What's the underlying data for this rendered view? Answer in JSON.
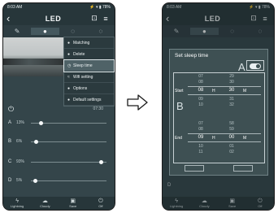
{
  "left_screen": {
    "status": {
      "time": "8:03 AM",
      "icons": "⚡ ▾ ▮ 78%"
    },
    "title": "LED",
    "menu": {
      "items": [
        {
          "label": "Matching"
        },
        {
          "label": "Delete"
        },
        {
          "label": "Sleep time"
        },
        {
          "label": "Wifi setting"
        },
        {
          "label": "Options"
        },
        {
          "label": "Default settings"
        }
      ]
    },
    "time_row": {
      "value": "07:30"
    },
    "channels": [
      {
        "letter": "A",
        "percent": "13%",
        "level": 0.13
      },
      {
        "letter": "B",
        "percent": "6%",
        "level": 0.06
      },
      {
        "letter": "C",
        "percent": "93%",
        "level": 0.93
      },
      {
        "letter": "D",
        "percent": "5%",
        "level": 0.05
      }
    ],
    "nav": [
      {
        "label": "Lightning"
      },
      {
        "label": "Cloudy"
      },
      {
        "label": "Save"
      },
      {
        "label": "Off"
      }
    ]
  },
  "right_screen": {
    "status": {
      "time": "8:03 AM",
      "icons": "⚡ ▾ ▮ 78%"
    },
    "title": "LED",
    "dialog": {
      "title": "Set sleep time",
      "letter_a": "A",
      "letter_b": "B",
      "toggle_on": true,
      "start": {
        "label": "Start",
        "hour_above": [
          "07",
          "08"
        ],
        "hour": "08",
        "hour_below": [
          "09",
          "10"
        ],
        "minute_above": [
          "29",
          "30"
        ],
        "minute": "30",
        "minute_below": [
          "31",
          "32"
        ],
        "hour_unit": "H",
        "minute_unit": "M"
      },
      "end": {
        "label": "End",
        "hour_above": [
          "07",
          "08"
        ],
        "hour": "09",
        "hour_below": [
          "10",
          "11"
        ],
        "minute_above": [
          "58",
          "59"
        ],
        "minute": "00",
        "minute_below": [
          "01",
          "02"
        ],
        "hour_unit": "H",
        "minute_unit": "M"
      }
    },
    "bg_channel": "D",
    "nav": [
      {
        "label": "Lightning"
      },
      {
        "label": "Cloudy"
      },
      {
        "label": "Save"
      },
      {
        "label": "Off"
      }
    ]
  },
  "icons": {
    "back": "‹",
    "sliders": "⊡",
    "menu": "≡",
    "power": "⏻",
    "arrow": "⇨"
  },
  "colors": {
    "screen_bg": "#34454a",
    "bar_bg": "#27363a",
    "dialog_bg": "#3e5053",
    "highlight": "#4f6267"
  }
}
